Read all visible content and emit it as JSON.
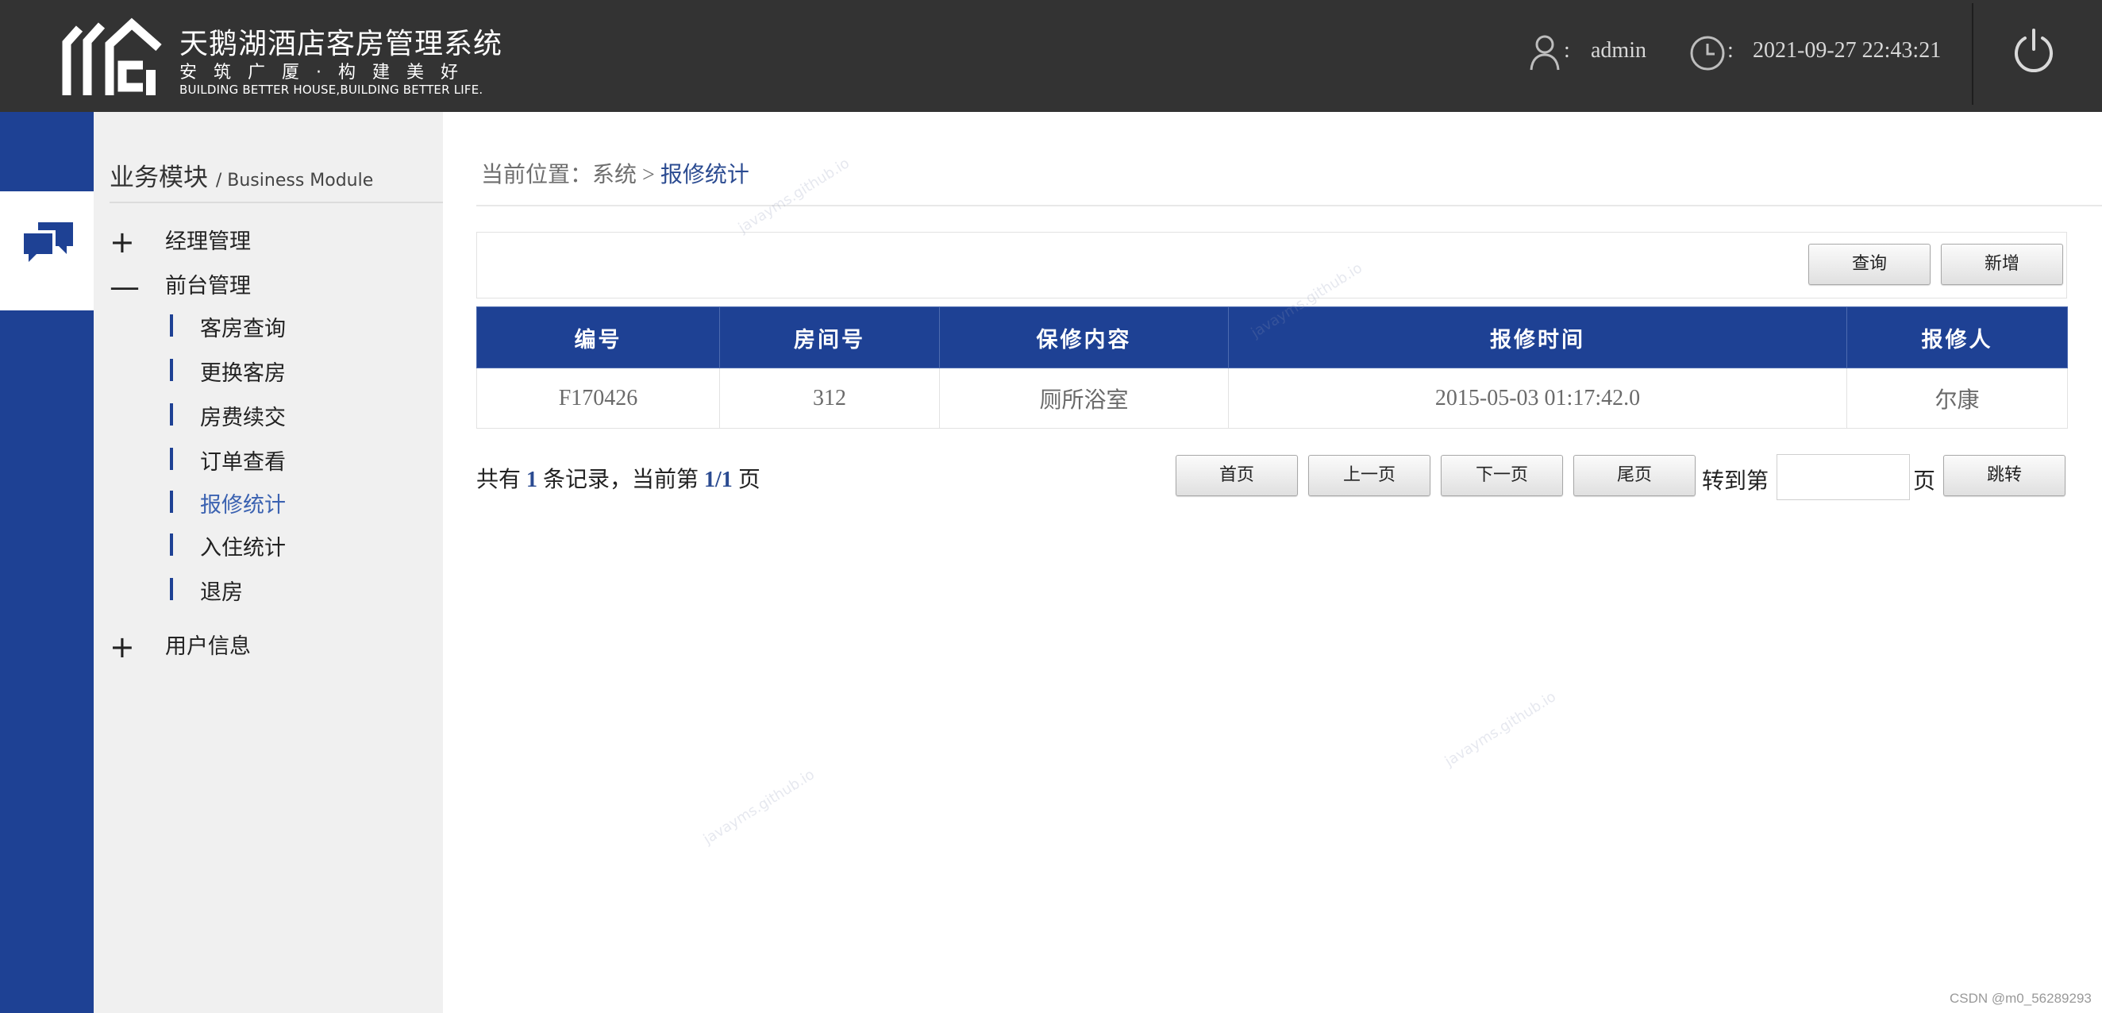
{
  "header": {
    "app_title": "天鹅湖酒店客房管理系统",
    "slogan": "安筑广厦·构建美好",
    "slogan_en": "BUILDING BETTER HOUSE,BUILDING BETTER LIFE.",
    "user_sep": ":",
    "username": "admin",
    "time_sep": ":",
    "datetime": "2021-09-27 22:43:21",
    "icons": {
      "user": "user-icon",
      "clock": "clock-icon",
      "logout": "power-icon"
    }
  },
  "sidebar": {
    "module_title": "业务模块",
    "module_title_en": "/ Business Module",
    "groups": [
      {
        "sign": "+",
        "label": "经理管理"
      },
      {
        "sign": "—",
        "label": "前台管理"
      },
      {
        "sign": "+",
        "label": "用户信息"
      }
    ],
    "sub_items": [
      {
        "label": "客房查询"
      },
      {
        "label": "更换客房"
      },
      {
        "label": "房费续交"
      },
      {
        "label": "订单查看"
      },
      {
        "label": "报修统计",
        "active": true
      },
      {
        "label": "入住统计"
      },
      {
        "label": "退房"
      }
    ]
  },
  "breadcrumb": {
    "prefix": "当前位置：",
    "parent": "系统",
    "sep": ">",
    "current": "报修统计"
  },
  "toolbar": {
    "query_label": "查询",
    "add_label": "新增"
  },
  "table": {
    "columns": [
      "编号",
      "房间号",
      "保修内容",
      "报修时间",
      "报修人"
    ],
    "rows": [
      [
        "F170426",
        "312",
        "厕所浴室",
        "2015-05-03 01:17:42.0",
        "尔康"
      ]
    ]
  },
  "pagination": {
    "summary_prefix": "共有",
    "total": "1",
    "summary_mid": "条记录，当前第",
    "page_info": "1/1",
    "summary_suffix": "页",
    "first_label": "首页",
    "prev_label": "上一页",
    "next_label": "下一页",
    "last_label": "尾页",
    "goto_label": "转到第",
    "goto_suffix": "页",
    "goto_value": "",
    "jump_label": "跳转"
  },
  "watermark": "javayms.github.io",
  "footer": {
    "credit": "CSDN @m0_56289293"
  },
  "colors": {
    "primary": "#1e4194",
    "header_bg": "#333333",
    "sidebar_bg": "#f0f0f0",
    "active_text": "#3b62b1"
  }
}
